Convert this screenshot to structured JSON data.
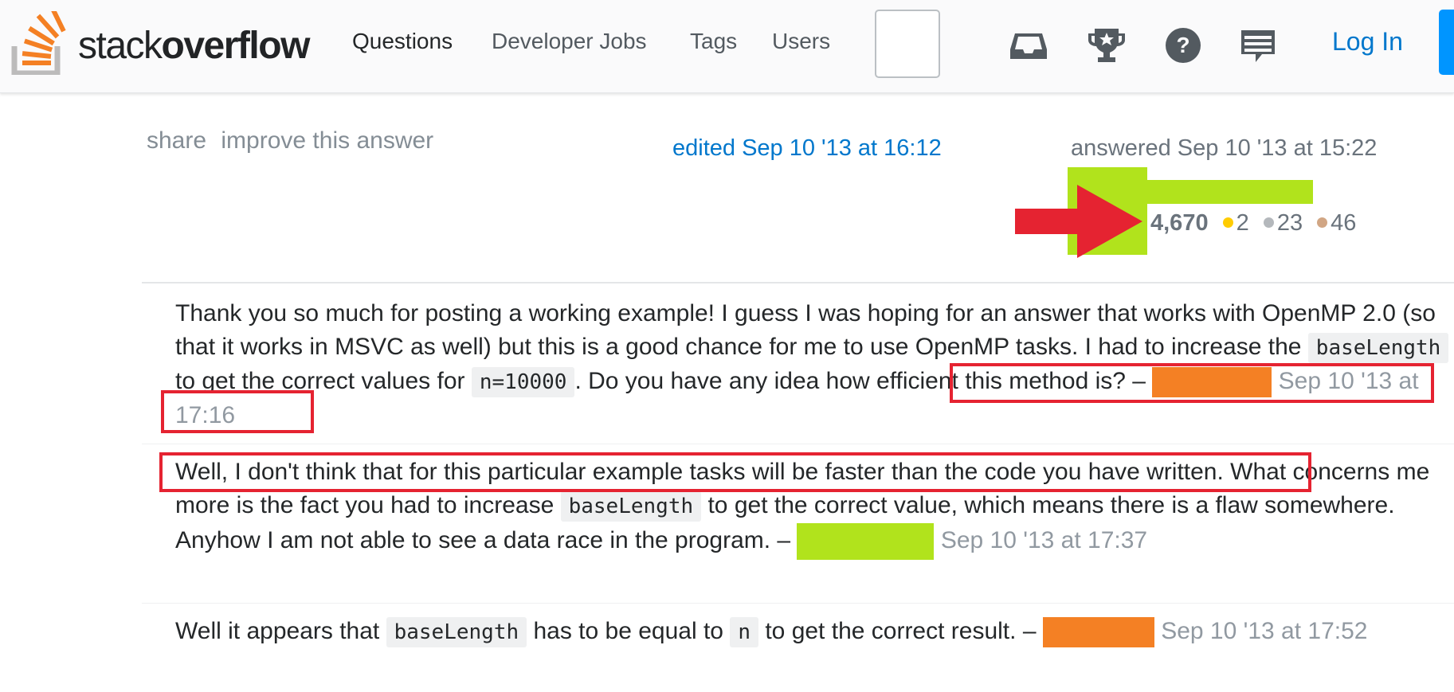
{
  "header": {
    "logo_prefix": "stack",
    "logo_suffix": "overflow",
    "nav": [
      "Questions",
      "Developer Jobs",
      "Tags",
      "Users"
    ],
    "icons": [
      "inbox-icon",
      "trophy-icon",
      "help-icon",
      "chat-icon"
    ],
    "login_label": "Log In"
  },
  "answer": {
    "menu": {
      "share": "share",
      "improve": "improve this answer"
    },
    "edited": "edited Sep 10 '13 at 16:12",
    "answered": "answered Sep 10 '13 at 15:22",
    "user": {
      "reputation": "4,670",
      "gold": "2",
      "silver": "23",
      "bronze": "46"
    }
  },
  "comments": [
    {
      "text_1": "Thank you so much for posting a working example! I guess I was hoping for an answer that works with OpenMP 2.0 (so that it works in MSVC as well) but this is a good chance for me to use OpenMP tasks. I had to increase the ",
      "code_1": "baseLength",
      "text_2": " to get the correct values for ",
      "code_2": "n=10000",
      "text_3": ". Do you have any idea how efficient this method is? – ",
      "date": "Sep 10 '13 at 17:16"
    },
    {
      "text_1": "Well, I don't think that for this particular example tasks will be faster than the code you have written. What concerns me more is the fact you had to increase ",
      "code_1": "baseLength",
      "text_2": " to get the correct value, which means there is a flaw somewhere. Anyhow I am not able to see a data race in the program. – ",
      "date": "Sep 10 '13 at 17:37"
    },
    {
      "text_1": "Well it appears that ",
      "code_1": "baseLength",
      "text_2": " has to be equal to ",
      "code_2": "n",
      "text_3": " to get the correct result. – ",
      "date": "Sep 10 '13 at 17:52"
    }
  ],
  "colors": {
    "brand_orange": "#f48024",
    "link_blue": "#0077cc",
    "highlight_red": "#e52331",
    "redaction_green": "#b1e31c"
  }
}
